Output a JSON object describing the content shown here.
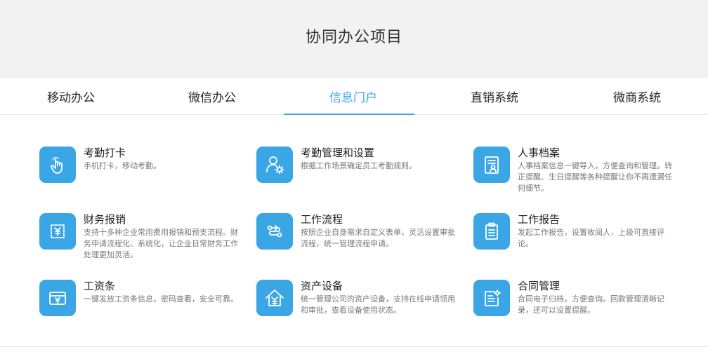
{
  "header": {
    "title": "协同办公项目"
  },
  "tabs": [
    {
      "label": "移动办公"
    },
    {
      "label": "微信办公"
    },
    {
      "label": "信息门户"
    },
    {
      "label": "直销系统"
    },
    {
      "label": "微商系统"
    }
  ],
  "active_tab": "信息门户",
  "accent_color": "#3ba6e6",
  "features": [
    {
      "title": "考勤打卡",
      "desc": "手机打卡，移动考勤。",
      "icon": "touch-hand-icon"
    },
    {
      "title": "考勤管理和设置",
      "desc": "根据工作场景确定员工考勤规则。",
      "icon": "user-gear-icon"
    },
    {
      "title": "人事档案",
      "desc": "人事档案信息一键导入，方便查询和管理。转正提醒、生日提醒等各种提醒让你不再遗漏任何细节。",
      "icon": "personnel-file-icon"
    },
    {
      "title": "财务报销",
      "desc": "支持十多种企业常用费用报销和预支流程。财务申请流程化、系统化，让企业日常财务工作处理更加灵活。",
      "icon": "receipt-yen-icon"
    },
    {
      "title": "工作流程",
      "desc": "按照企业自身需求自定义表单，灵活设置审批流程，统一管理流程申请。",
      "icon": "workflow-icon"
    },
    {
      "title": "工作报告",
      "desc": "发起工作报告，设置收阅人，上级可直接评论。",
      "icon": "clipboard-report-icon"
    },
    {
      "title": "工资条",
      "desc": "一键发放工资条信息，密码查看，安全可靠。",
      "icon": "payslip-icon"
    },
    {
      "title": "资产设备",
      "desc": "统一管理公司的资产设备，支持在线申请领用和审批，查看设备使用状态。",
      "icon": "asset-house-icon"
    },
    {
      "title": "合同管理",
      "desc": "合同电子归档，方便查询。回款管理清晰记录，还可以设置提醒。",
      "icon": "contract-gear-icon"
    }
  ]
}
